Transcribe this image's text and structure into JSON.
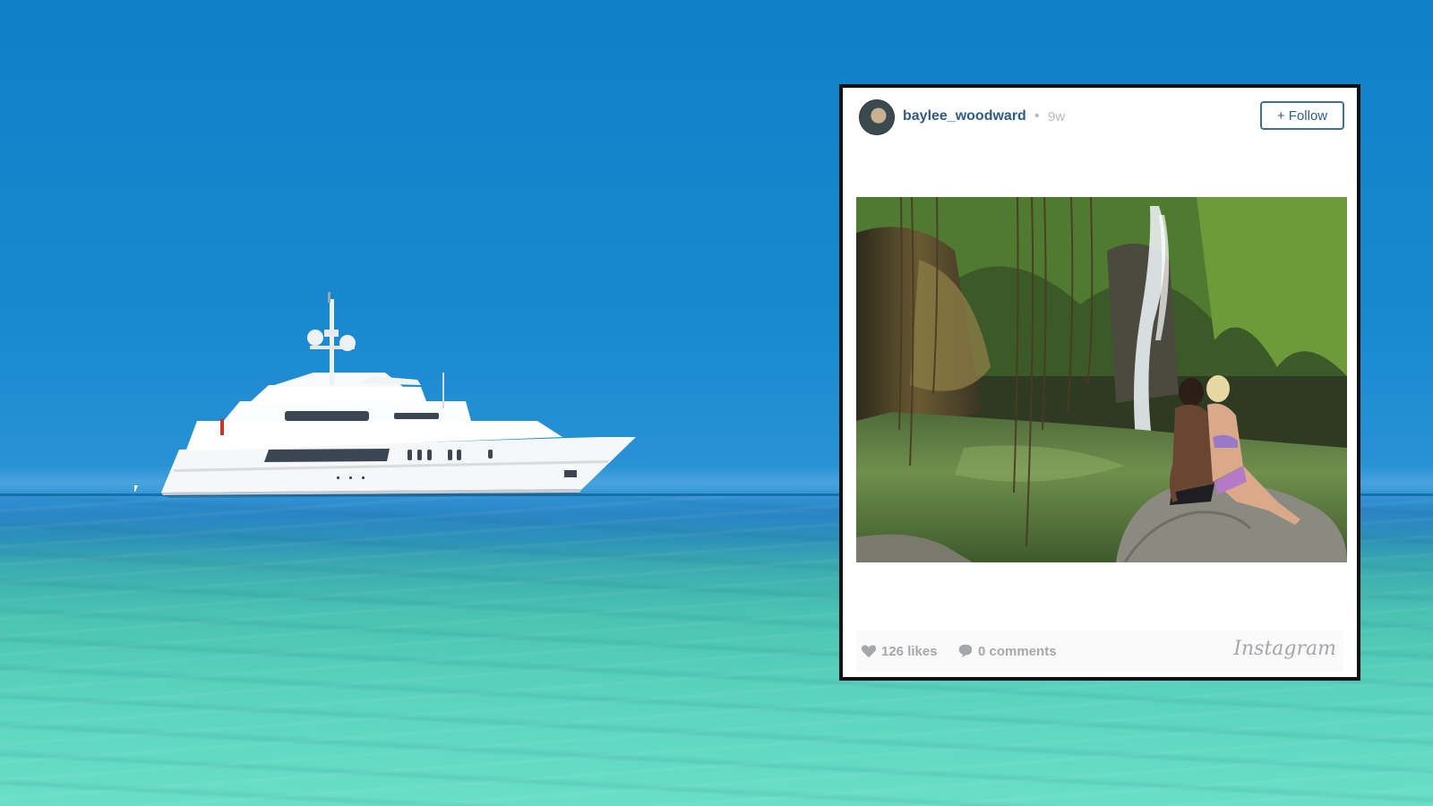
{
  "post": {
    "username": "baylee_woodward",
    "separator": "•",
    "age": "9w",
    "follow_label": "+ Follow",
    "likes": "126 likes",
    "comments": "0 comments",
    "brand": "Instagram",
    "photo_description_icon": "photo"
  },
  "colors": {
    "sky": "#0f7fc8",
    "sea": "#5ad3be",
    "card_border": "#111111",
    "username": "#2f5c85",
    "muted": "#a4a8ac"
  },
  "icons": {
    "likes": "heart-icon",
    "comments": "speech-bubble-icon"
  }
}
